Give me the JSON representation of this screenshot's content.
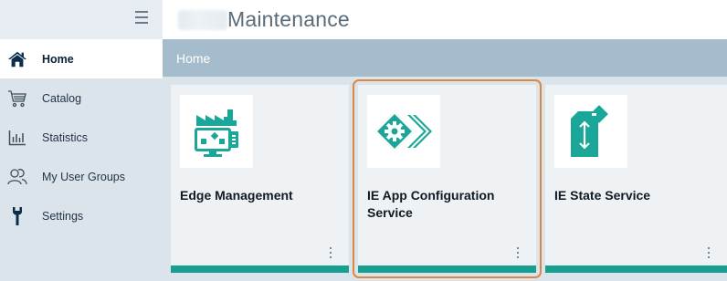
{
  "app": {
    "title": "Maintenance"
  },
  "sidebar": {
    "items": [
      {
        "label": "Home",
        "icon": "home-icon",
        "active": true
      },
      {
        "label": "Catalog",
        "icon": "cart-icon",
        "active": false
      },
      {
        "label": "Statistics",
        "icon": "bar-chart-icon",
        "active": false
      },
      {
        "label": "My User Groups",
        "icon": "user-group-icon",
        "active": false
      },
      {
        "label": "Settings",
        "icon": "wrench-icon",
        "active": false
      }
    ]
  },
  "breadcrumb": {
    "label": "Home"
  },
  "cards": [
    {
      "title": "Edge Management",
      "icon": "factory-monitor-icon",
      "selected": false
    },
    {
      "title": "IE App Configuration Service",
      "icon": "gear-chevrons-icon",
      "selected": true
    },
    {
      "title": "IE State Service",
      "icon": "state-transfer-icon",
      "selected": false
    }
  ],
  "colors": {
    "accent": "#199f91",
    "sidebar_bg": "#dbe4eb",
    "breadcrumb_bg": "#a4bccb",
    "selection_outline": "#e0873f",
    "icon_teal": "#1aa79a"
  }
}
